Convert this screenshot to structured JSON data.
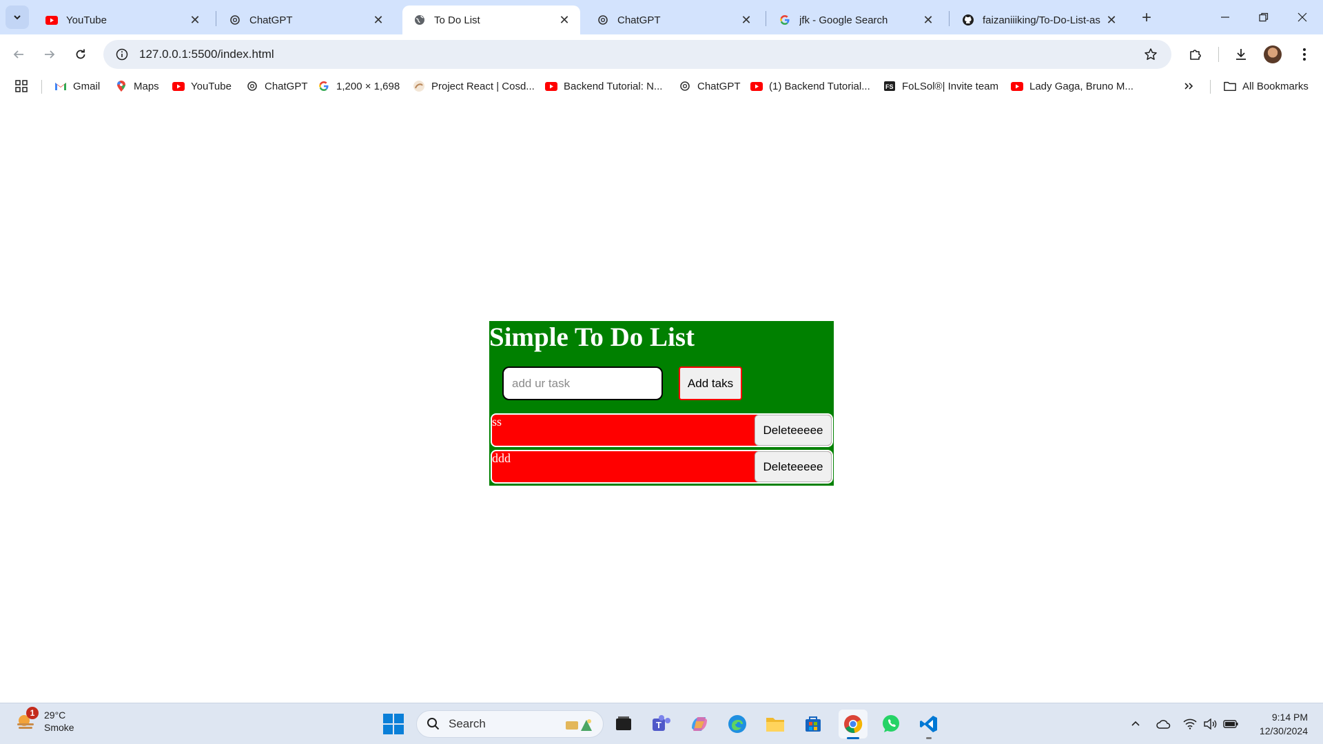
{
  "browser": {
    "tabs": [
      {
        "title": "YouTube",
        "icon": "youtube-icon"
      },
      {
        "title": "ChatGPT",
        "icon": "chatgpt-icon"
      },
      {
        "title": "To Do List",
        "icon": "globe-icon",
        "active": true
      },
      {
        "title": "ChatGPT",
        "icon": "chatgpt-icon"
      },
      {
        "title": "jfk - Google Search",
        "icon": "google-icon"
      },
      {
        "title": "faizaniiiking/To-Do-List-as",
        "icon": "github-icon"
      }
    ],
    "url": "127.0.0.1:5500/index.html",
    "bookmarks": [
      {
        "label": "Gmail",
        "icon": "gmail-icon"
      },
      {
        "label": "Maps",
        "icon": "maps-icon"
      },
      {
        "label": "YouTube",
        "icon": "youtube-icon"
      },
      {
        "label": "ChatGPT",
        "icon": "chatgpt-icon"
      },
      {
        "label": "1,200 × 1,698",
        "icon": "google-icon"
      },
      {
        "label": "Project React | Cosd...",
        "icon": "cosden-icon"
      },
      {
        "label": "Backend Tutorial: N...",
        "icon": "youtube-icon"
      },
      {
        "label": "ChatGPT",
        "icon": "chatgpt-icon"
      },
      {
        "label": "(1) Backend Tutorial...",
        "icon": "youtube-icon"
      },
      {
        "label": "FoLSol®| Invite team",
        "icon": "folsol-icon"
      },
      {
        "label": "Lady Gaga, Bruno M...",
        "icon": "youtube-icon"
      }
    ],
    "all_bookmarks": "All Bookmarks"
  },
  "app": {
    "title": "Simple To Do List",
    "input_placeholder": "add ur task",
    "add_button": "Add taks",
    "tasks": [
      {
        "text": "ss",
        "delete_label": "Deleteeeee"
      },
      {
        "text": "ddd",
        "delete_label": "Deleteeeee"
      }
    ],
    "colors": {
      "panel": "#008000",
      "task": "#ff0000"
    }
  },
  "taskbar": {
    "weather_temp": "29°C",
    "weather_desc": "Smoke",
    "weather_badge": "1",
    "search_label": "Search",
    "time": "9:14 PM",
    "date": "12/30/2024"
  }
}
